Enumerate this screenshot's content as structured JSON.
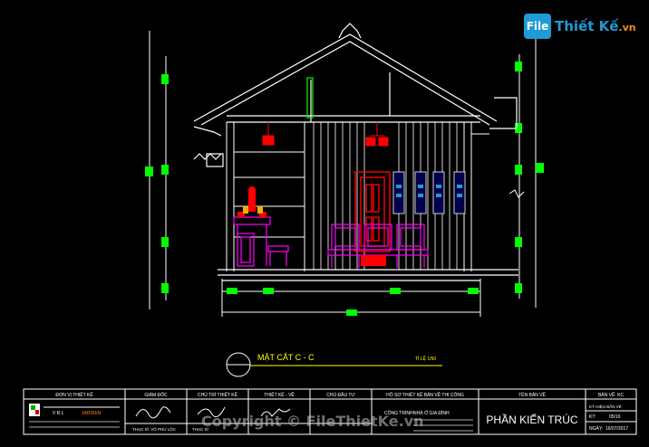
{
  "logo": {
    "box": "File",
    "name": "Thiết Kế",
    "ext": ".vn"
  },
  "drawing": {
    "section_title": "MẶT CẮT  C - C",
    "scale": "TỈ LỆ 1/50"
  },
  "title_block": {
    "headers": [
      "ĐƠN VỊ THIẾT KẾ",
      "GIÁM ĐỐC",
      "CHỦ TRÌ THIẾT KẾ",
      "THIẾT KẾ - VẼ",
      "CHỦ ĐẦU TƯ",
      "HỒ SƠ THIẾT KẾ BẢN VẼ THI CÔNG",
      "TÊN BẢN VẼ",
      "BẢN VẼ: KC"
    ],
    "company_code": "V R L",
    "company_name": "JARDIEN",
    "director": "THẠC SĨ. VÕ PHÚ LỘC",
    "designer": "THẠC SĨ",
    "project_label": "CÔNG TRÌNH:",
    "project_name": "NHÀ Ở GIA ĐÌNH",
    "sheet_name": "PHẦN KIẾN TRÚC",
    "sheet_symbol_label": "KÝ HIỆU BẢN VẼ",
    "sheet_number_label": "KT:",
    "sheet_number": "05/16",
    "date_label": "NGÀY:",
    "date": "16/07/2017"
  },
  "watermark": "Copyright © FileThietKe.vn",
  "colors": {
    "background": "#000000",
    "line_white": "#ffffff",
    "dim_green": "#00ff00",
    "furniture_magenta": "#ff00ff",
    "door_red": "#ff0000",
    "title_yellow": "#ffff00",
    "accent_blue": "#1f9ad6"
  }
}
